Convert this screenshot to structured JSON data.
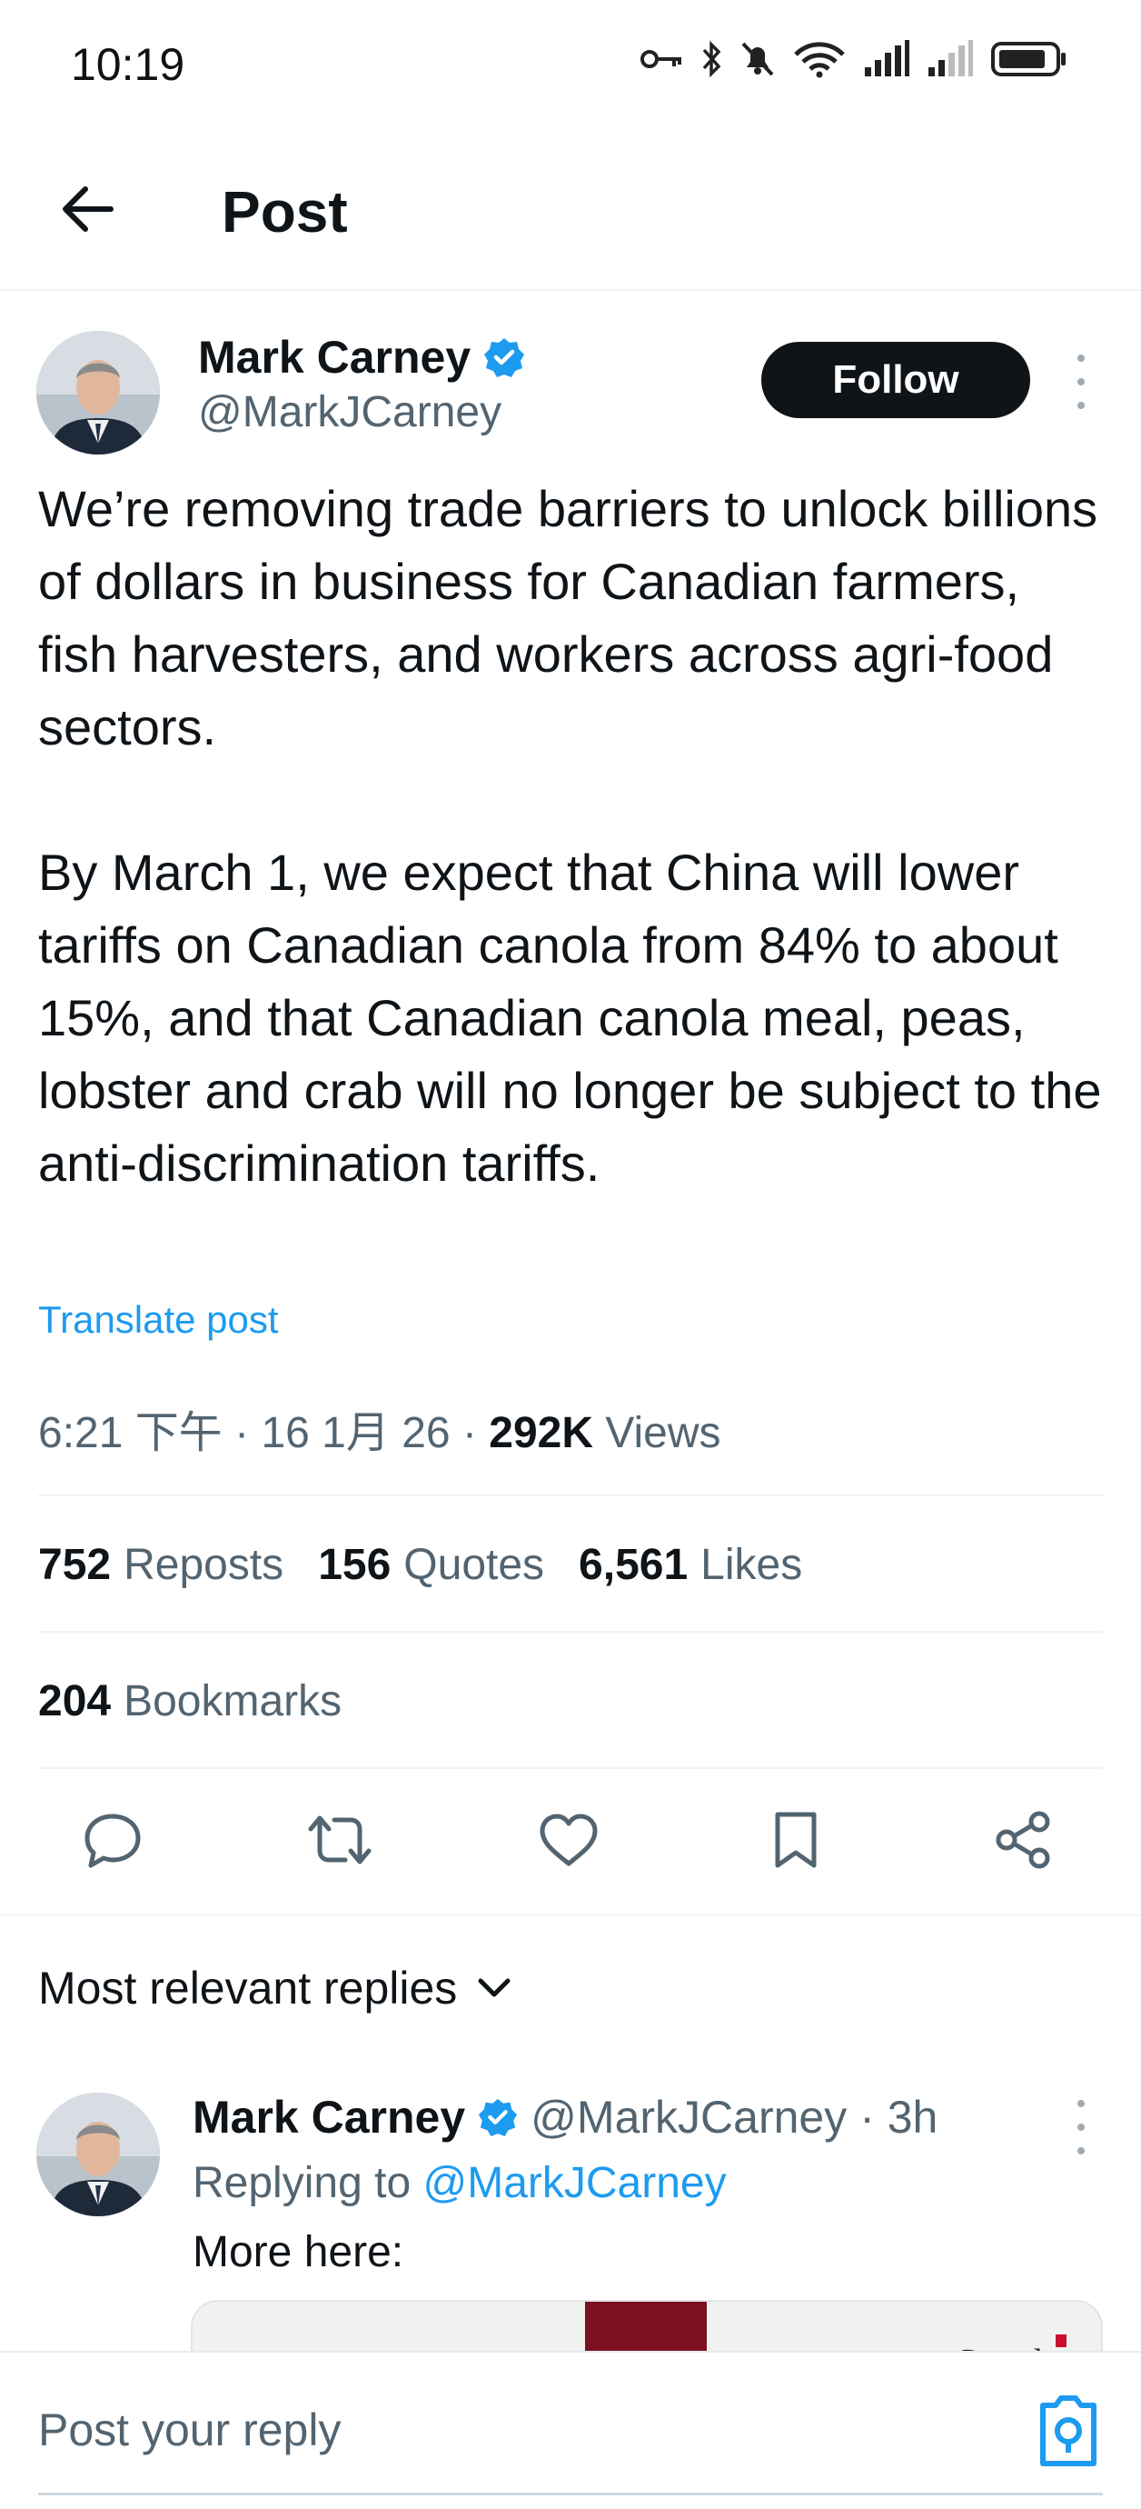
{
  "status_bar": {
    "time": "10:19"
  },
  "header": {
    "title": "Post"
  },
  "post": {
    "author": {
      "name": "Mark Carney",
      "handle": "@MarkJCarney",
      "verified": true
    },
    "follow_label": "Follow",
    "text": "We’re removing trade barriers to unlock billions of dollars in business for Canadian farmers, fish harvesters, and workers across agri-food sectors.\n\nBy March 1, we expect that China will lower tariffs on Canadian canola from 84% to about 15%, and that Canadian canola meal, peas, lobster and crab will no longer be subject to the anti-discrimination tariffs.",
    "translate_label": "Translate post",
    "meta": {
      "time": "6:21 下午",
      "date": "16 1月 26",
      "views_count": "292K",
      "views_label": "Views"
    },
    "stats": {
      "reposts_count": "752",
      "reposts_label": "Reposts",
      "quotes_count": "156",
      "quotes_label": "Quotes",
      "likes_count": "6,561",
      "likes_label": "Likes",
      "bookmarks_count": "204",
      "bookmarks_label": "Bookmarks"
    },
    "actions": [
      "reply-icon",
      "repost-icon",
      "like-icon",
      "bookmark-icon",
      "share-icon"
    ]
  },
  "replies": {
    "sort_label": "Most relevant replies",
    "items": [
      {
        "name": "Mark Carney",
        "handle": "@MarkJCarney",
        "time": "· 3h",
        "replying_prefix": "Replying to",
        "replying_to": "@MarkJCarney",
        "text": "More here:",
        "card_brand": "Canada"
      }
    ]
  },
  "composer": {
    "placeholder": "Post your reply"
  },
  "colors": {
    "accent": "#1d9bf0",
    "text_primary": "#0f1419",
    "text_secondary": "#536471",
    "follow_bg": "#0f1419"
  }
}
